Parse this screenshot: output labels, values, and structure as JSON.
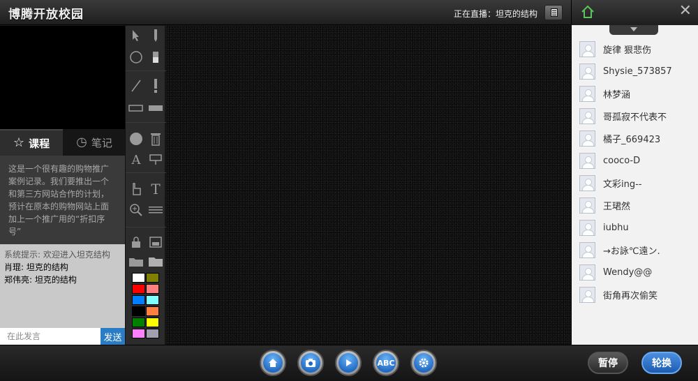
{
  "header": {
    "app_title": "博腾开放校园",
    "live_label": "正在直播：坦克的结构"
  },
  "tabs": [
    {
      "label": "课程",
      "icon": "star-icon"
    },
    {
      "label": "笔记",
      "icon": "clock-icon"
    }
  ],
  "course": {
    "description": "这是一个很有趣的购物推广案例记录。我们要推出一个和第三方网站合作的计划，预计在原本的购物网站上面加上一个推广用的“折扣序号”"
  },
  "chat": {
    "messages": [
      {
        "text": "系统提示: 欢迎进入坦克结构",
        "system": true
      },
      {
        "text": "肖琨: 坦克的结构",
        "system": false
      },
      {
        "text": "郑伟亮: 坦克的结构",
        "system": false
      }
    ],
    "input_placeholder": "在此发言",
    "send_label": "发送"
  },
  "palette": {
    "colors": [
      "#ffffff",
      "#808000",
      "#ff0000",
      "#ff8080",
      "#0080ff",
      "#80ffff",
      "#000000",
      "#ff8040",
      "#008000",
      "#ffff00",
      "#ff80ff",
      "#a0a0b0"
    ]
  },
  "users": [
    "旋律 狠悲伤",
    "Shysie_573857",
    "林梦涵",
    "哥孤寂不代表不",
    "橘子_669423",
    "cooco-D",
    "文彩ing--",
    "王珺然",
    "iubhu",
    "→お詠℃遠ン.",
    "Wendy@@",
    "街角再次偷笑"
  ],
  "controls": {
    "abc_label": "ABC",
    "pause_label": "暂停",
    "rotate_label": "轮换"
  }
}
